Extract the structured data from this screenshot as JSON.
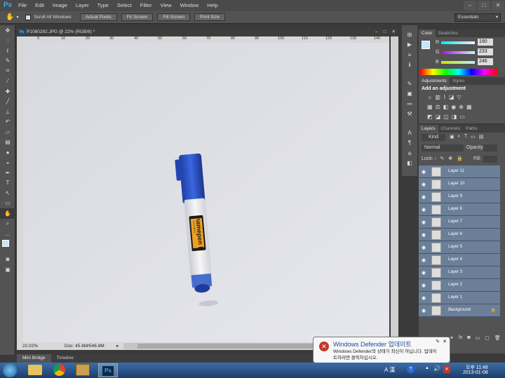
{
  "app": {
    "logo": "Ps"
  },
  "menu": [
    "File",
    "Edit",
    "Image",
    "Layer",
    "Type",
    "Select",
    "Filter",
    "View",
    "Window",
    "Help"
  ],
  "options": {
    "scroll_all_label": "Scroll All Windows",
    "buttons": [
      "Actual Pixels",
      "Fit Screen",
      "Fill Screen",
      "Print Size"
    ],
    "workspace": "Essentials"
  },
  "document": {
    "tab_title": "P1080292.JPG @ 22% (RGB/8) *",
    "ruler_ticks": [
      "0",
      "10",
      "20",
      "30",
      "40",
      "50",
      "60",
      "70",
      "80",
      "90",
      "100",
      "110",
      "120",
      "130",
      "140"
    ],
    "zoom": "22.02%",
    "doc_size": "Doc: 45.6M/546.8M"
  },
  "minibridge": {
    "tabs": [
      "Mini Bridge",
      "Timeline"
    ]
  },
  "color_panel": {
    "tabs": [
      "Color",
      "Swatches"
    ],
    "r_label": "R",
    "g_label": "G",
    "b_label": "B",
    "r": "190",
    "g": "233",
    "b": "246"
  },
  "adjustments_panel": {
    "tabs": [
      "Adjustments",
      "Styles"
    ],
    "title": "Add an adjustment"
  },
  "layers_panel": {
    "tabs": [
      "Layers",
      "Channels",
      "Paths"
    ],
    "filter": "Kind",
    "blend_mode": "Normal",
    "opacity_label": "Opacity:",
    "lock_label": "Lock:",
    "fill_label": "Fill:",
    "layers": [
      "Layer 11",
      "Layer 10",
      "Layer 9",
      "Layer 8",
      "Layer 7",
      "Layer 6",
      "Layer 5",
      "Layer 4",
      "Layer 3",
      "Layer 2",
      "Layer 1"
    ],
    "background": "Background"
  },
  "notification": {
    "title": "Windows Defender 업데이트",
    "line1": "Windows Defender의 상태가 최신이 아닙니다. 업데이",
    "line2": "트하려면 클릭하십시오."
  },
  "taskbar": {
    "ime": "A 漢",
    "time": "오후 11:48",
    "date": "2013-01-08",
    "ps_label": "Ps"
  },
  "pen": {
    "brand": "namepen F",
    "maker": "monami"
  },
  "colors": {
    "accent_blue": "#2a55c8",
    "layer_selected": "#6b7f98",
    "canvas": "#dcdde4"
  }
}
